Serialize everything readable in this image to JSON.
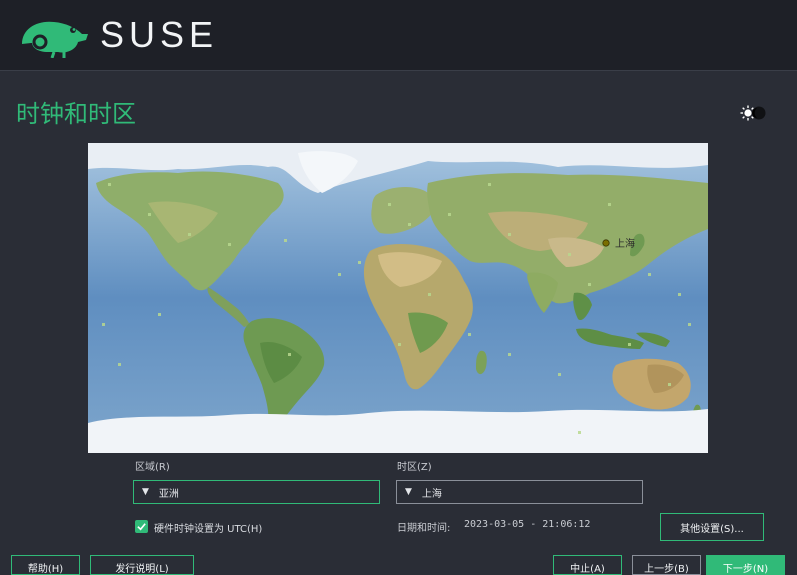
{
  "header": {
    "brand": "SUSE",
    "logo_icon": "chameleon-logo-icon"
  },
  "page": {
    "title": "时钟和时区",
    "theme_toggle_icon": "sun-moon-toggle-icon"
  },
  "map": {
    "selected_city": "上海",
    "marker_color": "#7a6f00"
  },
  "region": {
    "label": "区域(R)",
    "value": "亚洲"
  },
  "timezone": {
    "label": "时区(Z)",
    "value": "上海"
  },
  "hardware_clock": {
    "label": "硬件时钟设置为 UTC(H)",
    "checked": true
  },
  "datetime": {
    "label": "日期和时间:",
    "value": "2023-03-05 - 21:06:12"
  },
  "buttons": {
    "other_settings": "其他设置(S)...",
    "bottom_1": "帮助(H)",
    "bottom_2": "发行说明(L)",
    "bottom_3": "中止(A)",
    "bottom_4": "上一步(B)",
    "bottom_5": "下一步(N)"
  },
  "colors": {
    "accent": "#30ba78",
    "background": "#2a2d36",
    "header": "#1e2027"
  }
}
